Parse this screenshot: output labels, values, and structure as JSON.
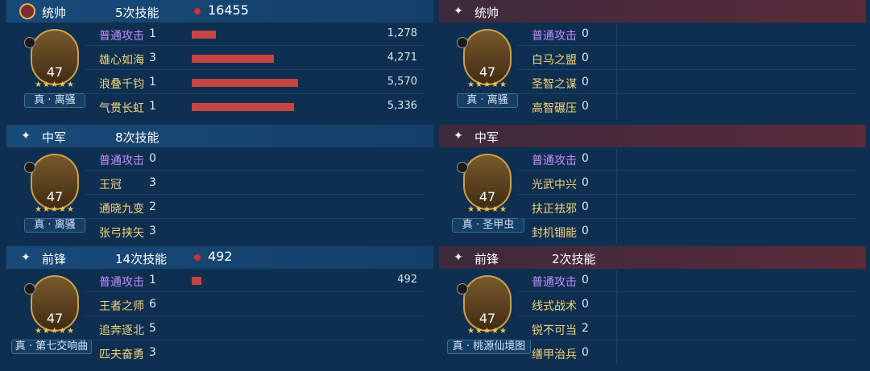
{
  "left": {
    "sections": [
      {
        "role": "统帅",
        "skill_count": "5次技能",
        "total": "16455",
        "hero": {
          "level": "47",
          "name": "真 · 离骚"
        },
        "skills": [
          {
            "name": "普通攻击",
            "count": "1",
            "value": "1,278",
            "bar": 0.23
          },
          {
            "name": "雄心如海",
            "count": "3",
            "value": "4,271",
            "bar": 0.77
          },
          {
            "name": "浪叠千钧",
            "count": "1",
            "value": "5,570",
            "bar": 1.0
          },
          {
            "name": "气贯长虹",
            "count": "1",
            "value": "5,336",
            "bar": 0.96
          }
        ]
      },
      {
        "role": "中军",
        "skill_count": "8次技能",
        "total": "",
        "hero": {
          "level": "47",
          "name": "真 · 离骚"
        },
        "skills": [
          {
            "name": "普通攻击",
            "count": "0",
            "value": "",
            "bar": 0
          },
          {
            "name": "王冠",
            "count": "3",
            "value": "",
            "bar": 0
          },
          {
            "name": "通晓九变",
            "count": "2",
            "value": "",
            "bar": 0
          },
          {
            "name": "张弓挟矢",
            "count": "3",
            "value": "",
            "bar": 0
          }
        ]
      },
      {
        "role": "前锋",
        "skill_count": "14次技能",
        "total": "492",
        "hero": {
          "level": "47",
          "name": "真 · 第七交响曲"
        },
        "skills": [
          {
            "name": "普通攻击",
            "count": "1",
            "value": "492",
            "bar": 0.09
          },
          {
            "name": "王者之师",
            "count": "6",
            "value": "",
            "bar": 0
          },
          {
            "name": "追奔逐北",
            "count": "5",
            "value": "",
            "bar": 0
          },
          {
            "name": "匹夫奋勇",
            "count": "3",
            "value": "",
            "bar": 0
          }
        ]
      }
    ]
  },
  "right": {
    "sections": [
      {
        "role": "统帅",
        "skill_count": "",
        "total": "",
        "hero": {
          "level": "47",
          "name": "真 · 离骚"
        },
        "skills": [
          {
            "name": "普通攻击",
            "count": "0"
          },
          {
            "name": "白马之盟",
            "count": "0"
          },
          {
            "name": "圣智之谋",
            "count": "0"
          },
          {
            "name": "高智碾压",
            "count": "0"
          }
        ]
      },
      {
        "role": "中军",
        "skill_count": "",
        "total": "",
        "hero": {
          "level": "47",
          "name": "真 · 圣甲虫"
        },
        "skills": [
          {
            "name": "普通攻击",
            "count": "0"
          },
          {
            "name": "光武中兴",
            "count": "0"
          },
          {
            "name": "扶正祛邪",
            "count": "0"
          },
          {
            "name": "封机锢能",
            "count": "0"
          }
        ]
      },
      {
        "role": "前锋",
        "skill_count": "2次技能",
        "total": "",
        "hero": {
          "level": "47",
          "name": "真 · 桃源仙境图"
        },
        "skills": [
          {
            "name": "普通攻击",
            "count": "0"
          },
          {
            "name": "线式战术",
            "count": "0"
          },
          {
            "name": "锐不可当",
            "count": "2"
          },
          {
            "name": "缮甲治兵",
            "count": "0"
          }
        ]
      }
    ]
  },
  "colors": {
    "background": "#0e2f4f",
    "header_blue": "#184a78",
    "header_red": "#5a2b39",
    "bar_red": "#c84343",
    "skill_gold": "#f3d37a",
    "skill_purple": "#c58bff"
  },
  "icons": {
    "left_header_first": "sword-badge-icon",
    "header_generic": "sparkle-icon",
    "damage_dot": "red-dot-icon",
    "avatar_badge": "buff-badge-icon"
  }
}
